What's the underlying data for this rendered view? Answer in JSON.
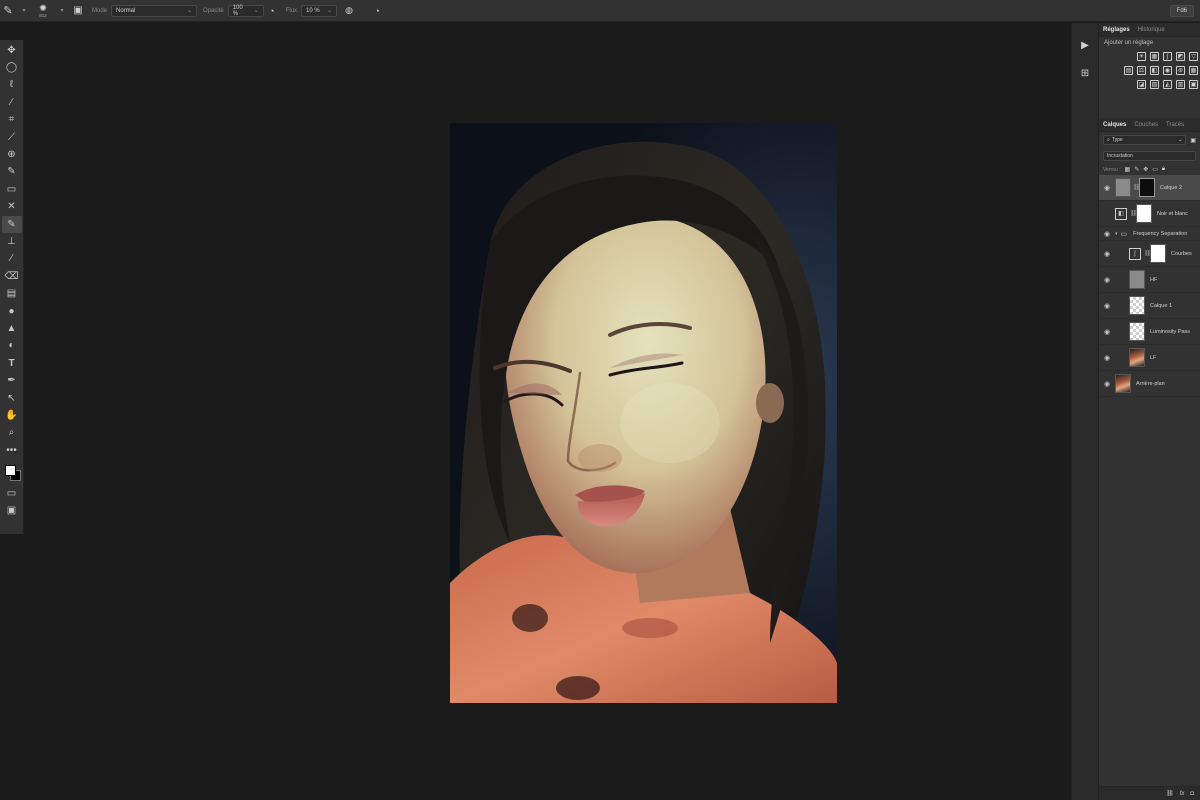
{
  "options_bar": {
    "brush_size": "812",
    "mode_label": "Mode",
    "mode_value": "Normal",
    "opacity_label": "Opacité",
    "opacity_value": "100 %",
    "flow_label": "Flux",
    "flow_value": "10 %",
    "share_label": "Fd6"
  },
  "toolbar": {
    "tools": [
      "move-icon",
      "marquee-icon",
      "lasso-icon",
      "magic-wand-icon",
      "crop-icon",
      "eyedropper-icon",
      "healing-icon",
      "brush-icon",
      "clone-stamp-icon",
      "history-brush-icon",
      "eraser-icon",
      "gradient-icon",
      "blur-icon",
      "dodge-icon",
      "pen-icon",
      "type-icon",
      "path-selection-icon",
      "shape-icon",
      "hand-icon",
      "zoom-icon",
      "more-tools-icon"
    ],
    "active_tool": "brush-icon",
    "foreground_color": "#ffffff",
    "background_color": "#000000"
  },
  "right_panel": {
    "top_tabs": [
      "Réglages",
      "Historique"
    ],
    "adjust_title": "Ajouter un réglage",
    "layers_tabs": [
      "Calques",
      "Couches",
      "Tracés"
    ],
    "filter_value": "Type",
    "blend_mode": "Incrustation",
    "lock_label": "Verrou :",
    "layers": [
      {
        "name": "Calque 2",
        "visible": true,
        "selected": true,
        "kind": "layer-mask"
      },
      {
        "name": "Noir et blanc",
        "visible": false,
        "selected": false,
        "kind": "adjustment"
      },
      {
        "name": "Frequency Separation",
        "visible": true,
        "selected": false,
        "kind": "group"
      },
      {
        "name": "Courbes",
        "visible": true,
        "selected": false,
        "kind": "adjustment-child"
      },
      {
        "name": "HF",
        "visible": true,
        "selected": false,
        "kind": "gray"
      },
      {
        "name": "Calque 1",
        "visible": true,
        "selected": false,
        "kind": "checker"
      },
      {
        "name": "Luminosity Pass",
        "visible": true,
        "selected": false,
        "kind": "checker"
      },
      {
        "name": "LF",
        "visible": true,
        "selected": false,
        "kind": "portrait-child"
      },
      {
        "name": "Arrière-plan",
        "visible": true,
        "selected": false,
        "kind": "portrait"
      }
    ]
  }
}
